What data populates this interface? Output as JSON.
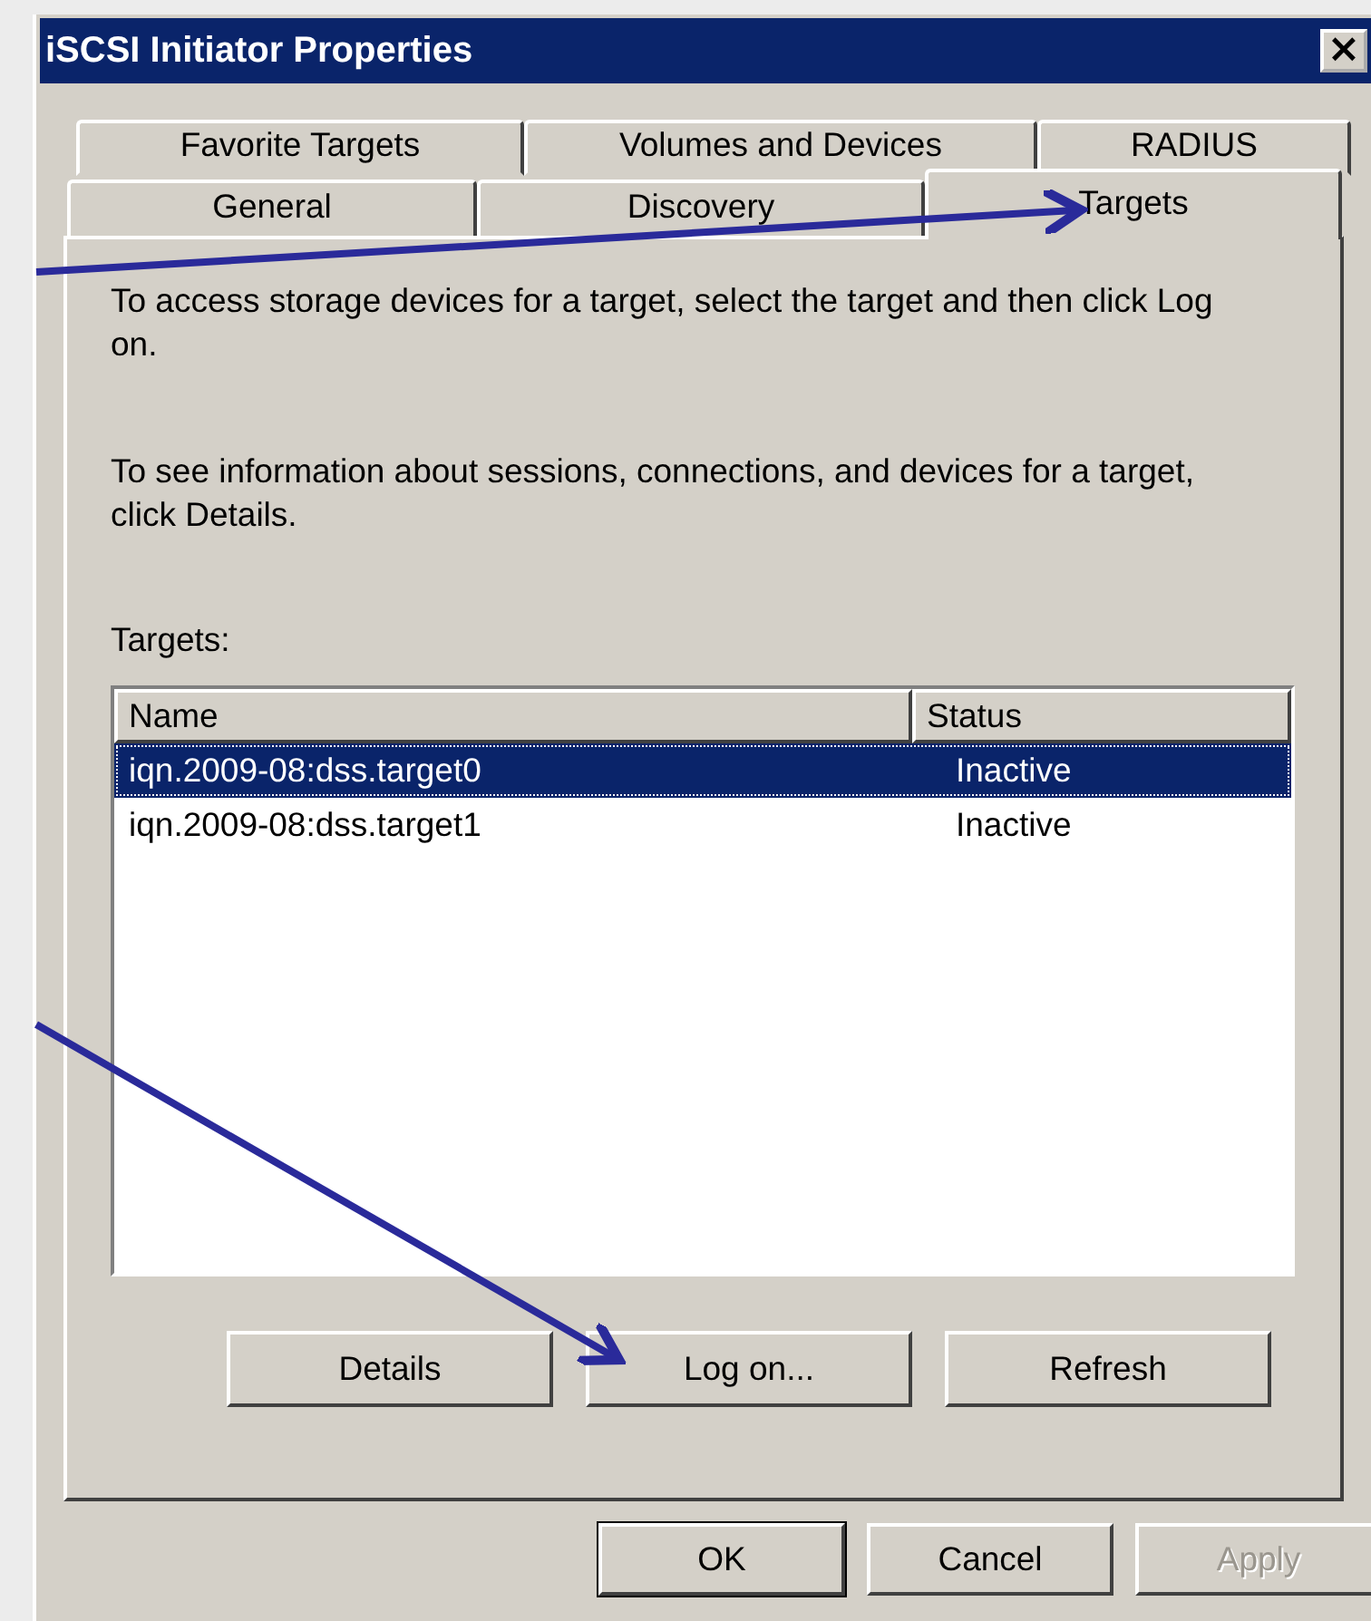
{
  "window": {
    "title": "iSCSI Initiator Properties",
    "close": "×"
  },
  "tab_rows": [
    [
      {
        "label": "Favorite Targets",
        "selected": false
      },
      {
        "label": "Volumes and Devices",
        "selected": false
      },
      {
        "label": "RADIUS",
        "selected": false
      }
    ],
    [
      {
        "label": "General",
        "selected": false
      },
      {
        "label": "Discovery",
        "selected": false
      },
      {
        "label": "Targets",
        "selected": true
      }
    ]
  ],
  "paragraphs": [
    "To access storage devices for a target, select the target and then click Log on.",
    "To see information about sessions, connections, and devices for a target, click Details."
  ],
  "targets_label": "Targets:",
  "table": {
    "columns": [
      "Name",
      "Status"
    ],
    "rows": [
      {
        "name": "iqn.2009-08:dss.target0",
        "status": "Inactive",
        "selected": true
      },
      {
        "name": "iqn.2009-08:dss.target1",
        "status": "Inactive",
        "selected": false
      }
    ]
  },
  "panel_buttons": [
    {
      "label": "Details",
      "disabled": false
    },
    {
      "label": "Log on...",
      "disabled": false
    },
    {
      "label": "Refresh",
      "disabled": false
    }
  ],
  "dialog_buttons": [
    {
      "label": "OK",
      "disabled": false,
      "default": true
    },
    {
      "label": "Cancel",
      "disabled": false,
      "default": false
    },
    {
      "label": "Apply",
      "disabled": true,
      "default": false
    }
  ]
}
